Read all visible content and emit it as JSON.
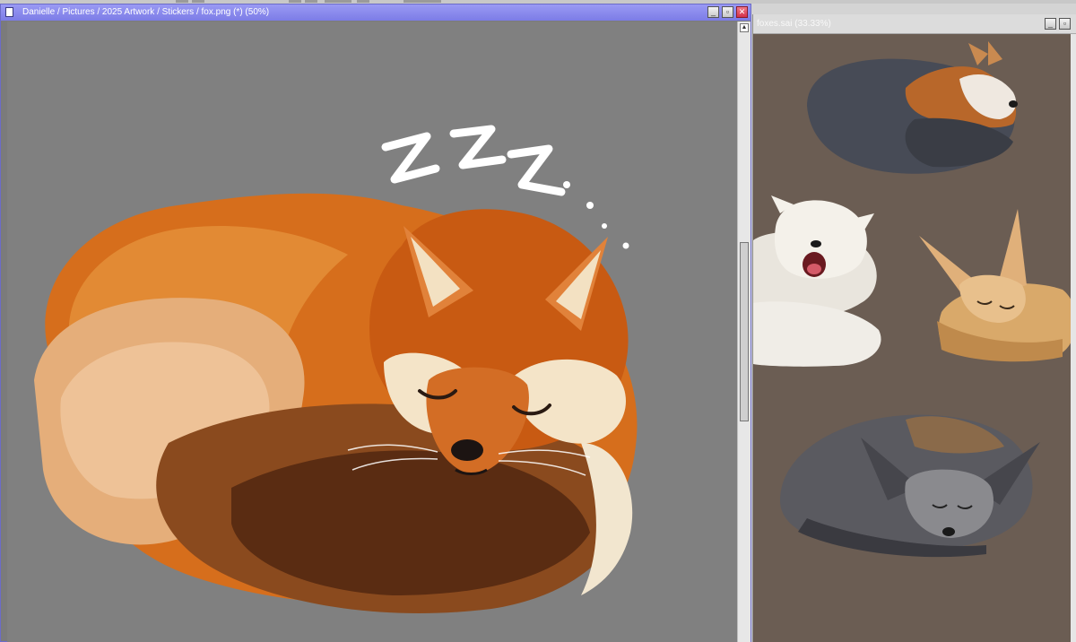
{
  "left_window": {
    "title": "Danielle / Pictures / 2025 Artwork / Stickers / fox.png (*) (50%)",
    "buttons": {
      "minimize": "_",
      "restore": "▫",
      "close": "✕"
    },
    "artwork": "red fox curled up sleeping",
    "zzz": "Z Z Z"
  },
  "right_window": {
    "title": "foxes.sai (33.33%)",
    "buttons": {
      "minimize": "_",
      "restore": "▫"
    },
    "artwork": [
      "grey fox sleeping",
      "arctic fox yawning",
      "fennec fox sleeping",
      "bat-eared fox sleeping"
    ]
  },
  "colors": {
    "left_canvas_bg": "#808080",
    "right_canvas_bg": "#6b5d53",
    "titlebar_active": "#8a8aee",
    "fox_orange": "#d9731f"
  }
}
